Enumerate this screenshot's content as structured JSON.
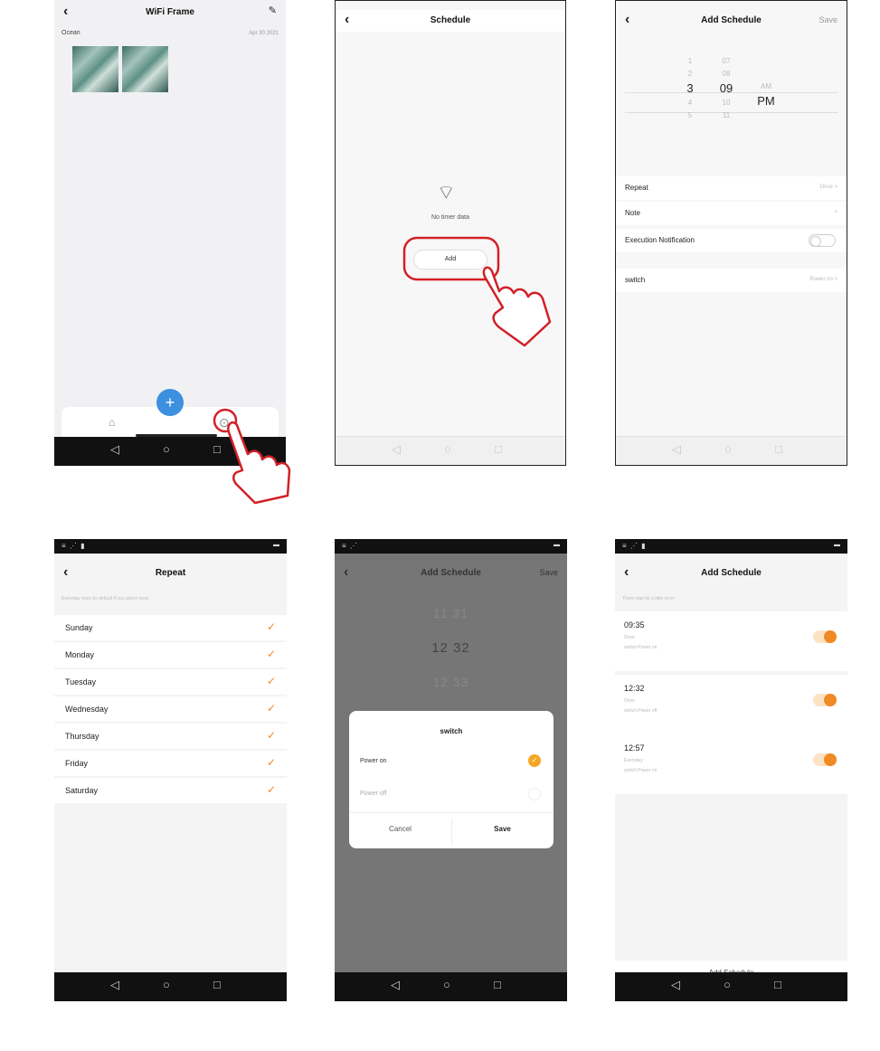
{
  "screen1": {
    "title": "WiFi Frame",
    "folder_name": "Ocean",
    "date": "Apr 30 2021",
    "fab_label": "+",
    "icons": [
      "back-icon",
      "edit-icon",
      "home-icon",
      "settings-icon",
      "add-icon"
    ]
  },
  "screen2": {
    "title": "Schedule",
    "empty_text": "No timer data",
    "add_label": "Add"
  },
  "screen3": {
    "title": "Add Schedule",
    "save_label": "Save",
    "hours": [
      "1",
      "2",
      "3",
      "4",
      "5"
    ],
    "minutes": [
      "07",
      "08",
      "09",
      "10",
      "11"
    ],
    "meridiem": [
      "AM",
      "PM"
    ],
    "repeat_label": "Repeat",
    "repeat_value": "Once >",
    "note_label": "Note",
    "note_value": ">",
    "notification_label": "Execution Notification",
    "switch_label": "switch",
    "switch_value": "Power on >"
  },
  "screen4": {
    "title": "Repeat",
    "hint": "Everyday once by default if you select none",
    "days": [
      "Sunday",
      "Monday",
      "Tuesday",
      "Wednesday",
      "Thursday",
      "Friday",
      "Saturday"
    ],
    "check": "✓"
  },
  "screen5": {
    "title": "Add Schedule",
    "save_label": "Save",
    "time_prev": "11  31",
    "time_sel": "12  32",
    "time_next": "12  33",
    "dialog_title": "switch",
    "option_on": "Power on",
    "option_off": "Power off",
    "cancel_label": "Cancel",
    "dialog_save": "Save"
  },
  "screen6": {
    "title": "Add Schedule",
    "hint": "There may be a little error",
    "schedules": [
      {
        "time": "09:35",
        "repeat": "Once",
        "action": "switch:Power on"
      },
      {
        "time": "12:32",
        "repeat": "Once",
        "action": "switch:Power off"
      },
      {
        "time": "12:57",
        "repeat": "Everyday",
        "action": "switch:Power on"
      }
    ],
    "add_label": "Add Schedule"
  },
  "nav_glyphs": {
    "back": "◁",
    "home": "○",
    "recent": "□"
  },
  "colors": {
    "accent_orange": "#f08a24",
    "fab_blue": "#3d8fe0",
    "annotation_red": "#d22027"
  }
}
